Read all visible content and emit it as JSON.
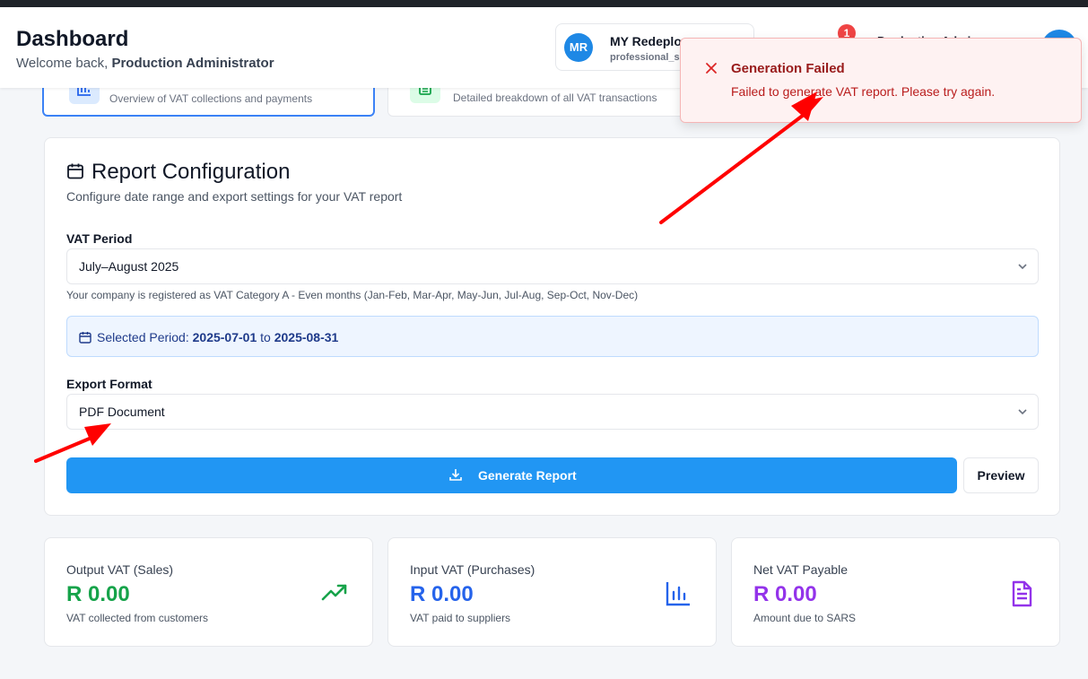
{
  "header": {
    "title": "Dashboard",
    "welcome_prefix": "Welcome back,",
    "welcome_name": "Production Administrator",
    "company": {
      "initials": "MR",
      "name": "MY Redeploy",
      "plan": "professional_s"
    },
    "notification_count": "1",
    "user_name": "Production Admi"
  },
  "tabs": [
    {
      "description": "Overview of VAT collections and payments",
      "icon": "bar-chart-icon",
      "active": true
    },
    {
      "description": "Detailed breakdown of all VAT transactions",
      "icon": "document-icon",
      "active": false
    }
  ],
  "report_config": {
    "title": "Report Configuration",
    "description": "Configure date range and export settings for your VAT report",
    "vat_period_label": "VAT Period",
    "vat_period_value": "July–August 2025",
    "vat_period_hint": "Your company is registered as VAT Category A - Even months (Jan-Feb, Mar-Apr, May-Jun, Jul-Aug, Sep-Oct, Nov-Dec)",
    "selected_period_label": "Selected Period:",
    "selected_from": "2025-07-01",
    "selected_to_word": "to",
    "selected_to": "2025-08-31",
    "export_format_label": "Export Format",
    "export_format_value": "PDF Document",
    "generate_label": "Generate Report",
    "preview_label": "Preview"
  },
  "stats": [
    {
      "title": "Output VAT (Sales)",
      "value": "R 0.00",
      "subtitle": "VAT collected from customers",
      "color": "#16a34a",
      "icon": "trending-up-icon"
    },
    {
      "title": "Input VAT (Purchases)",
      "value": "R 0.00",
      "subtitle": "VAT paid to suppliers",
      "color": "#2563eb",
      "icon": "bar-chart-icon"
    },
    {
      "title": "Net VAT Payable",
      "value": "R 0.00",
      "subtitle": "Amount due to SARS",
      "color": "#9333ea",
      "icon": "file-text-icon"
    }
  ],
  "toast": {
    "title": "Generation Failed",
    "message": "Failed to generate VAT report. Please try again.",
    "color": "#dc2626"
  },
  "colors": {
    "accent": "#2196f3",
    "annotation_arrow": "#ff0000"
  }
}
